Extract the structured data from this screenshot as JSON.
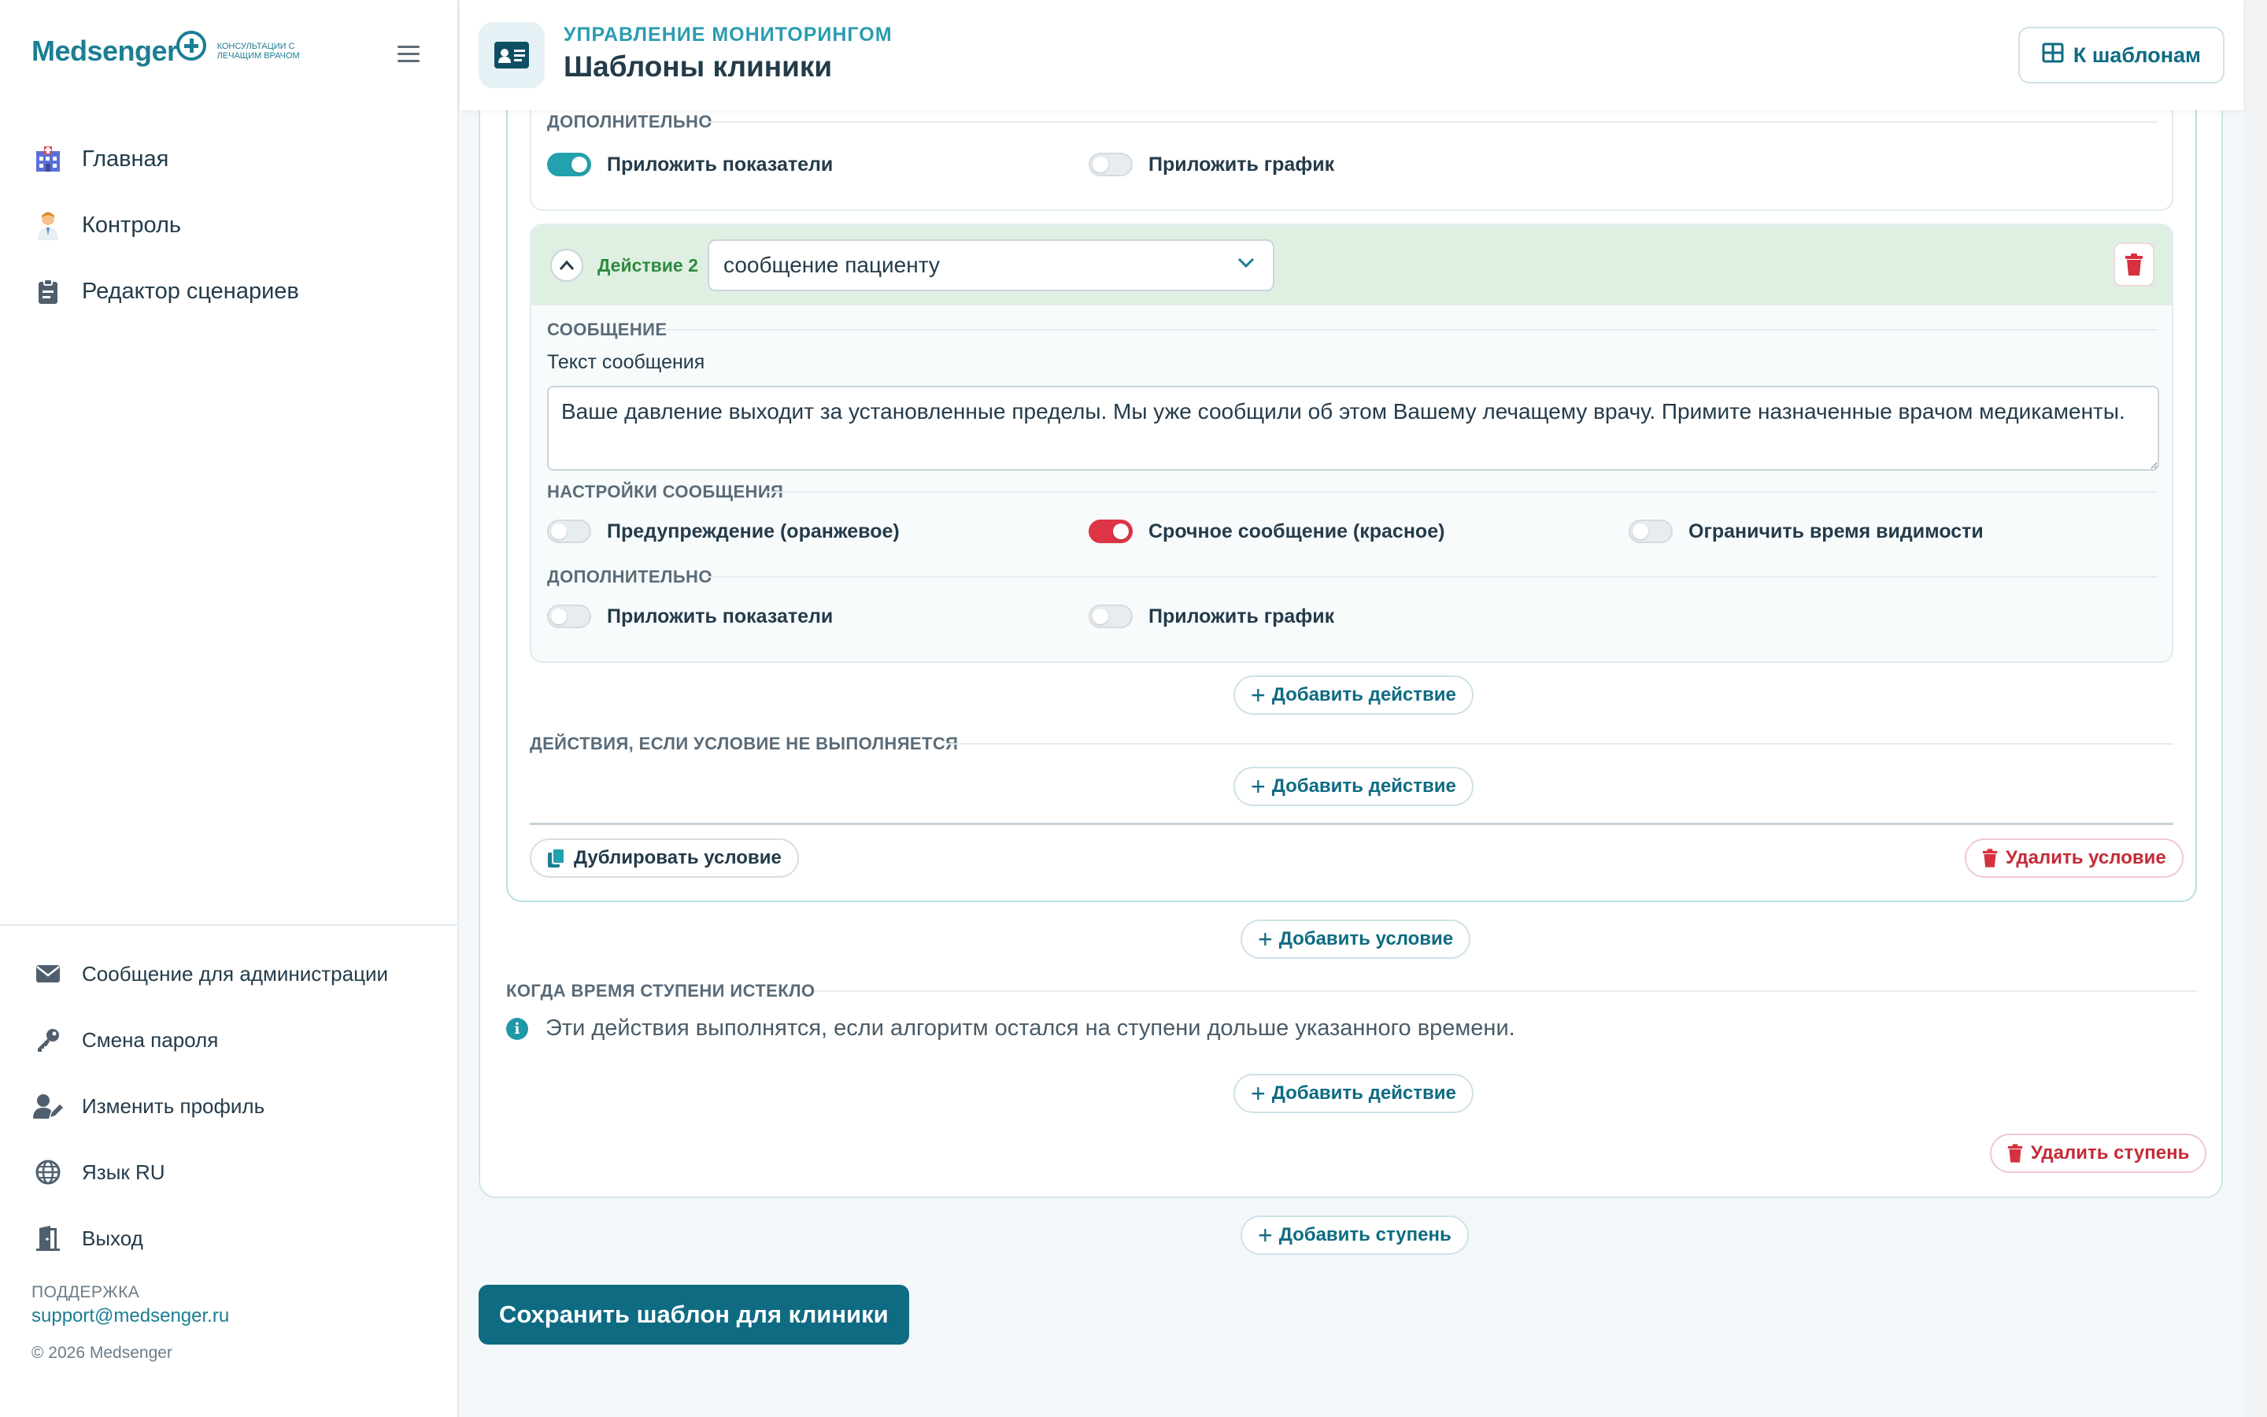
{
  "app": {
    "logo_text": "Medsenger",
    "logo_tagline": "консультации с лечащим врачом"
  },
  "sidebar": {
    "items": [
      {
        "label": "Главная",
        "icon": "hospital-icon"
      },
      {
        "label": "Контроль",
        "icon": "doctor-icon"
      },
      {
        "label": "Редактор сценариев",
        "icon": "clipboard-icon"
      }
    ],
    "bottom_items": [
      {
        "label": "Сообщение для администрации",
        "icon": "envelope-icon"
      },
      {
        "label": "Смена пароля",
        "icon": "key-icon"
      },
      {
        "label": "Изменить профиль",
        "icon": "user-edit-icon"
      },
      {
        "label": "Язык RU",
        "icon": "globe-icon"
      },
      {
        "label": "Выход",
        "icon": "door-icon"
      }
    ],
    "support_label": "ПОДДЕРЖКА",
    "support_email": "support@medsenger.ru",
    "copyright": "© 2026 Medsenger"
  },
  "header": {
    "kicker": "УПРАВЛЕНИЕ МОНИТОРИНГОМ",
    "title": "Шаблоны клиники",
    "templates_button": "К шаблонам"
  },
  "action1": {
    "extra_label": "ДОПОЛНИТЕЛЬНО",
    "attach_indicators": {
      "label": "Приложить показатели",
      "on": true
    },
    "attach_chart": {
      "label": "Приложить график",
      "on": false
    }
  },
  "action2": {
    "label": "Действие 2",
    "type_value": "сообщение пациенту",
    "message_section": "СООБЩЕНИЕ",
    "text_label": "Текст сообщения",
    "text_value": "Ваше давление выходит за установленные пределы. Мы уже сообщили об этом Вашему лечащему врачу. Примите назначенные врачом медикаменты.",
    "settings_section": "НАСТРОЙКИ СООБЩЕНИЯ",
    "warning": {
      "label": "Предупреждение (оранжевое)",
      "on": false
    },
    "urgent": {
      "label": "Срочное сообщение (красное)",
      "on": true
    },
    "limit_visibility": {
      "label": "Ограничить время видимости",
      "on": false
    },
    "extra_section": "ДОПОЛНИТЕЛЬНО",
    "attach_indicators": {
      "label": "Приложить показатели",
      "on": false
    },
    "attach_chart": {
      "label": "Приложить график",
      "on": false
    }
  },
  "condition": {
    "add_action": "Добавить действие",
    "else_section": "ДЕЙСТВИЯ, ЕСЛИ УСЛОВИЕ НЕ ВЫПОЛНЯЕТСЯ",
    "else_add_action": "Добавить действие",
    "duplicate": "Дублировать условие",
    "delete": "Удалить условие"
  },
  "step": {
    "add_condition": "Добавить условие",
    "expired_section": "КОГДА ВРЕМЯ СТУПЕНИ ИСТЕКЛО",
    "expired_info": "Эти действия выполнятся, если алгоритм остался на ступени дольше указанного времени.",
    "expired_add_action": "Добавить действие",
    "delete_step": "Удалить ступень"
  },
  "add_step": "Добавить ступень",
  "save_button": "Сохранить шаблон для клиники",
  "colors": {
    "accent": "#0f6b82",
    "teal_toggle": "#24a1ae",
    "red_toggle": "#dd3545",
    "action_header_bg": "#dff0e3",
    "danger": "#c52a37"
  }
}
